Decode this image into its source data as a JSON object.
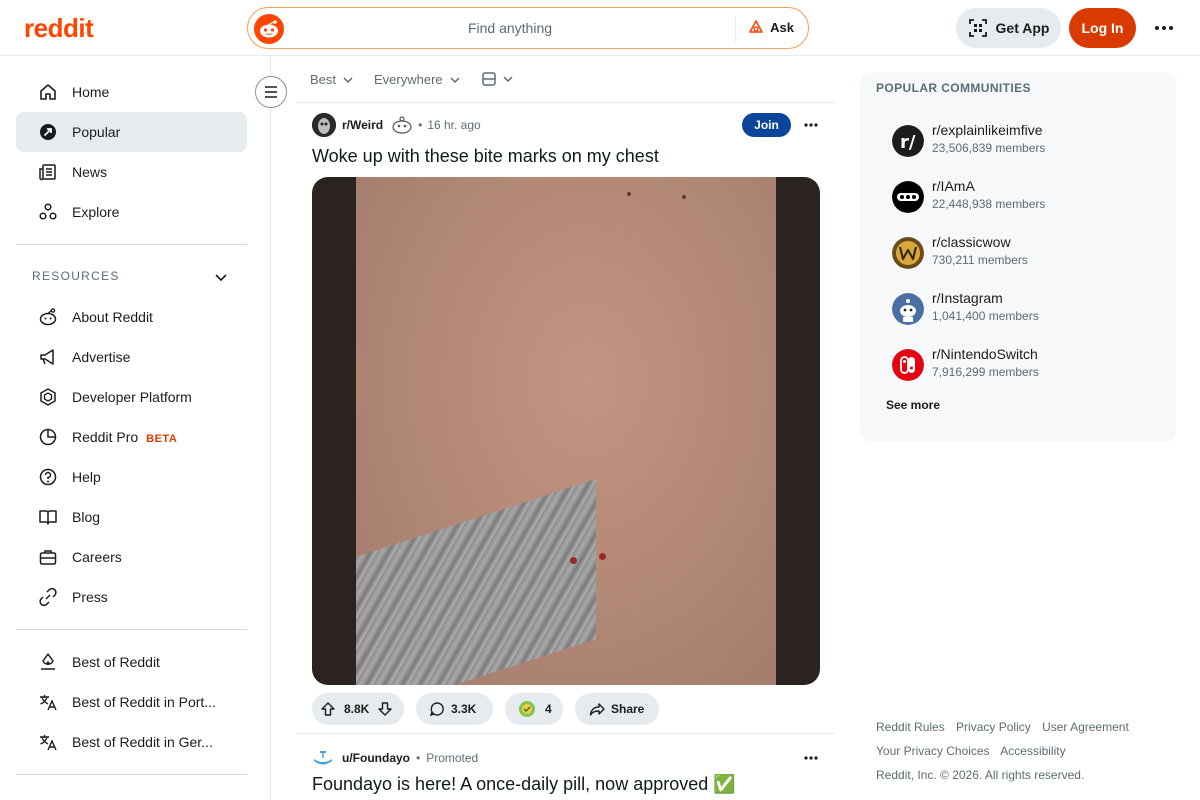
{
  "header": {
    "logo_text": "reddit",
    "search_placeholder": "Find anything",
    "ask_label": "Ask",
    "get_app_label": "Get App",
    "login_label": "Log In"
  },
  "sidebar": {
    "main_items": [
      {
        "label": "Home",
        "icon": "home-icon"
      },
      {
        "label": "Popular",
        "icon": "popular-icon",
        "active": true
      },
      {
        "label": "News",
        "icon": "news-icon"
      },
      {
        "label": "Explore",
        "icon": "explore-icon"
      }
    ],
    "resources_header": "RESOURCES",
    "resource_items": [
      {
        "label": "About Reddit",
        "icon": "reddit-alien-icon"
      },
      {
        "label": "Advertise",
        "icon": "megaphone-icon"
      },
      {
        "label": "Developer Platform",
        "icon": "hexagon-icon"
      },
      {
        "label": "Reddit Pro",
        "icon": "pie-chart-icon",
        "badge": "BETA"
      },
      {
        "label": "Help",
        "icon": "help-icon"
      },
      {
        "label": "Blog",
        "icon": "book-icon"
      },
      {
        "label": "Careers",
        "icon": "briefcase-icon"
      },
      {
        "label": "Press",
        "icon": "link-icon"
      }
    ],
    "best_items": [
      {
        "label": "Best of Reddit",
        "icon": "best-icon"
      },
      {
        "label": "Best of Reddit in Port...",
        "icon": "translate-icon"
      },
      {
        "label": "Best of Reddit in Ger...",
        "icon": "translate-icon"
      }
    ]
  },
  "sortbar": {
    "sort": "Best",
    "location": "Everywhere"
  },
  "post": {
    "subreddit": "r/Weird",
    "separator": "•",
    "time": "16 hr. ago",
    "join_label": "Join",
    "title": "Woke up with these bite marks on my chest",
    "upvotes": "8.8K",
    "comments": "3.3K",
    "awards": "4",
    "share_label": "Share"
  },
  "promo": {
    "user": "u/Foundayo",
    "separator": "•",
    "tag": "Promoted",
    "title": "Foundayo is here! A once-daily pill, now approved ✅"
  },
  "communities": {
    "title": "POPULAR COMMUNITIES",
    "items": [
      {
        "name": "r/explainlikeimfive",
        "members": "23,506,839 members",
        "color": "#1c1c1c"
      },
      {
        "name": "r/IAmA",
        "members": "22,448,938 members",
        "color": "#000000"
      },
      {
        "name": "r/classicwow",
        "members": "730,211 members",
        "color": "#c8a030"
      },
      {
        "name": "r/Instagram",
        "members": "1,041,400 members",
        "color": "#4a6fa5"
      },
      {
        "name": "r/NintendoSwitch",
        "members": "7,916,299 members",
        "color": "#e60012"
      }
    ],
    "see_more": "See more"
  },
  "footer": {
    "links_row1": [
      "Reddit Rules",
      "Privacy Policy",
      "User Agreement"
    ],
    "links_row2": [
      "Your Privacy Choices",
      "Accessibility"
    ],
    "copyright": "Reddit, Inc. © 2026. All rights reserved."
  }
}
